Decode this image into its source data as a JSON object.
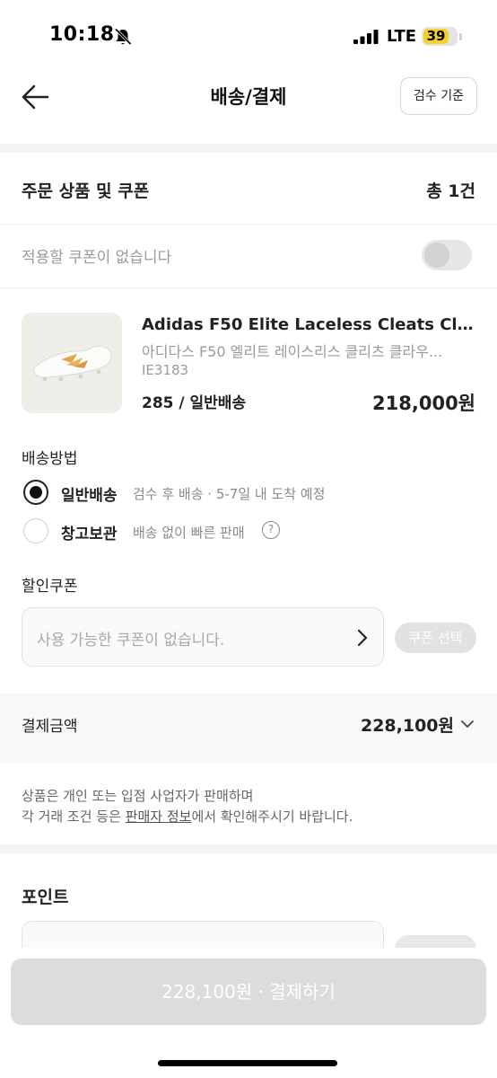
{
  "status_bar": {
    "time": "10:18",
    "network": "LTE",
    "battery": "39",
    "battery_color": "#f5cf2a"
  },
  "header": {
    "title": "배송/결제",
    "criteria_label": "검수 기준",
    "back_icon": "arrow-left-icon"
  },
  "order": {
    "title": "주문 상품 및 쿠폰",
    "count": "총 1건",
    "coupon_status": "적용할 쿠폰이 없습니다",
    "coupon_toggle_on": false
  },
  "product": {
    "name": "Adidas F50 Elite Laceless Cleats Clou...",
    "name_ko": "아디다스 F50 엘리트 레이스리스 클리츠 클라우...",
    "code": "IE3183",
    "option": "285 / 일반배송",
    "price": "218,000원"
  },
  "shipping": {
    "title": "배송방법",
    "options": [
      {
        "label": "일반배송",
        "desc": "검수 후 배송 · 5-7일 내 도착 예정",
        "selected": true
      },
      {
        "label": "창고보관",
        "desc": "배송 없이 빠른 판매",
        "selected": false
      }
    ],
    "help_glyph": "?"
  },
  "discount": {
    "title": "할인쿠폰",
    "placeholder": "사용 가능한 쿠폰이 없습니다.",
    "select_label": "쿠폰 선택"
  },
  "payment": {
    "label": "결제금액",
    "amount": "228,100원"
  },
  "notice": {
    "line1": "상품은 개인 또는 입점 사업자가 판매하며",
    "line2_prefix": "각 거래 조건 등은 ",
    "line2_link": "판매자 정보",
    "line2_suffix": "에서 확인해주시기 바랍니다."
  },
  "points": {
    "title": "포인트"
  },
  "bottom": {
    "pay_button": "228,100원 · 결제하기",
    "pay_button_color": "#dcdcdc"
  }
}
